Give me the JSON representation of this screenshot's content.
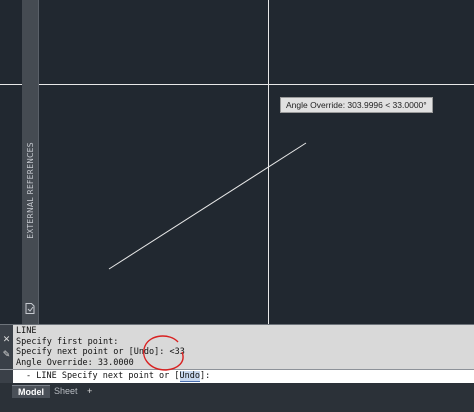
{
  "palette": {
    "canvas_bg": "#212830",
    "crosshair": "#e8e8e8",
    "line": "#e8e8e8",
    "tooltip_bg": "#e1e1e1",
    "command_bg": "#d9d9d9",
    "annotation": "#d92020"
  },
  "canvas": {
    "crosshair_icon": "crosshair-cursor",
    "tooltip_text": "Angle Override: 303.9996 < 33.0000°"
  },
  "palette_strip": {
    "label": "EXTERNAL REFERENCES",
    "icon": "xref-document-icon"
  },
  "command_line": {
    "history": [
      "LINE",
      "Specify first point:",
      "Specify next point or [Undo]: <33",
      "Angle Override: 33.0000"
    ],
    "close_icon": "close-icon",
    "customize_icon": "wrench-icon",
    "input": {
      "prompt_icon": "command-prompt-arrow-icon",
      "prefix": "- LINE Specify next point or [",
      "option": "Undo",
      "suffix": "]:"
    }
  },
  "layout_tabs": {
    "model": "Model",
    "sheet": "Sheet",
    "add": "+"
  }
}
